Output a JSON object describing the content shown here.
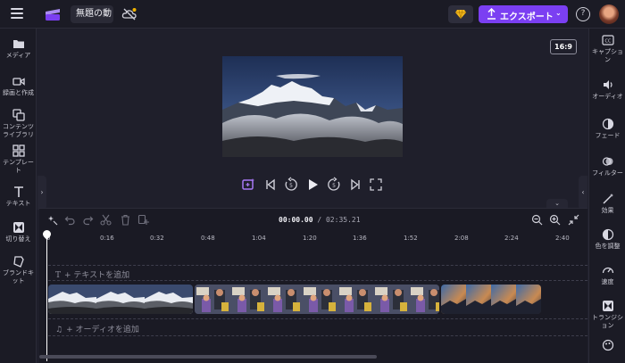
{
  "topbar": {
    "project_title": "無題の動",
    "export_label": "エクスポート"
  },
  "leftbar": {
    "items": [
      {
        "label": "メディア"
      },
      {
        "label": "録画と作成"
      },
      {
        "label": "コンテンツ\nライブラリ"
      },
      {
        "label": "テンプレー\nト"
      },
      {
        "label": "テキスト"
      },
      {
        "label": "切り替え"
      },
      {
        "label": "ブランドキ\nット"
      }
    ]
  },
  "rightbar": {
    "items": [
      {
        "label": "キャプショ\nン"
      },
      {
        "label": "オーディオ"
      },
      {
        "label": "フェード"
      },
      {
        "label": "フィルター"
      },
      {
        "label": "効果"
      },
      {
        "label": "色を調整"
      },
      {
        "label": "速度"
      },
      {
        "label": "トランジシ\nョン"
      }
    ]
  },
  "canvas": {
    "aspect_ratio": "16:9"
  },
  "timeline": {
    "current_time": "00:00.00",
    "total_time": "/ 02:35.21",
    "ticks": [
      "0",
      "0:16",
      "0:32",
      "0:48",
      "1:04",
      "1:20",
      "1:36",
      "1:52",
      "2:08",
      "2:24",
      "2:40"
    ],
    "add_text_label": "+ テキストを追加",
    "add_audio_label": "+ オーディオを追加"
  },
  "colors": {
    "accent": "#7b3ff2",
    "background": "#1f1f2b",
    "panel": "#1b1b25"
  }
}
